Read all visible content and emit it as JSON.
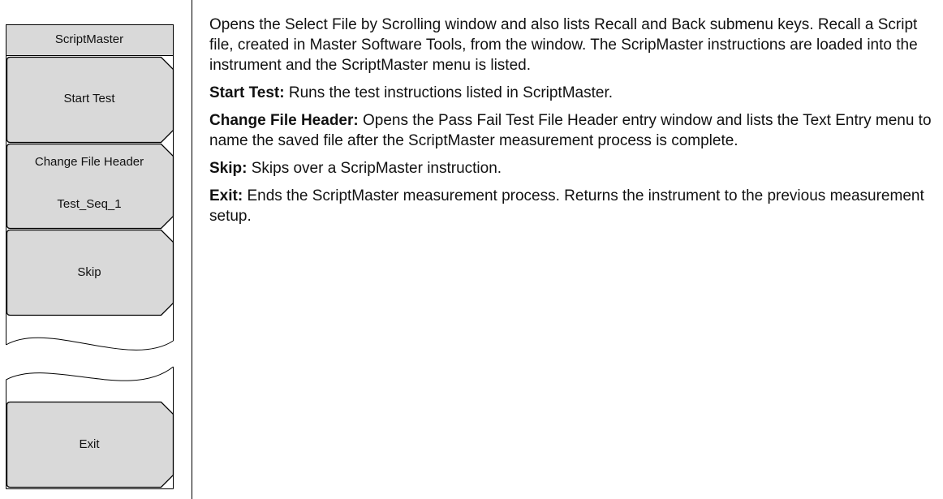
{
  "menu": {
    "title": "ScriptMaster",
    "keys": [
      {
        "id": "start-test",
        "label": "Start Test"
      },
      {
        "id": "change-file-header",
        "label": "Change File Header",
        "value": "Test_Seq_1"
      },
      {
        "id": "skip",
        "label": "Skip"
      },
      {
        "id": "exit",
        "label": "Exit"
      }
    ]
  },
  "descriptions": {
    "intro": "Opens the Select File by Scrolling window and also lists Recall and Back submenu keys. Recall a Script file, created in Master Software Tools, from the window. The ScripMaster instructions are loaded into the instrument and the ScriptMaster menu is listed.",
    "items": [
      {
        "term": "Start Test:",
        "text": " Runs the test instructions listed in ScriptMaster."
      },
      {
        "term": "Change File Header:",
        "text": " Opens the Pass Fail Test File Header entry window and lists the Text Entry menu to name the saved file after the ScriptMaster measurement process is complete."
      },
      {
        "term": "Skip:",
        "text": " Skips over a ScripMaster instruction."
      },
      {
        "term": "Exit:",
        "text": " Ends the ScriptMaster measurement process. Returns the instrument to the previous measurement setup."
      }
    ]
  }
}
